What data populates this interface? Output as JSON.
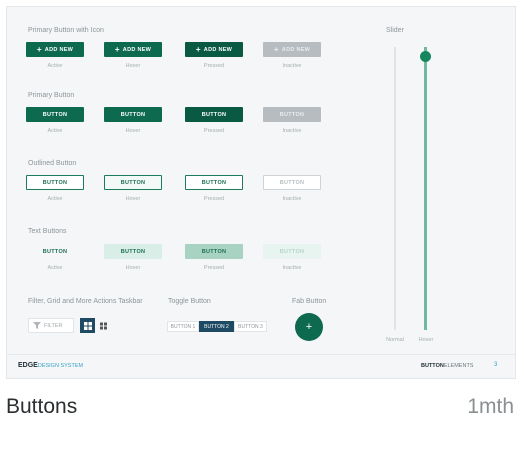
{
  "sections": {
    "primary_icon": {
      "title": "Primary Button with Icon",
      "buttons": [
        {
          "label": "ADD NEW",
          "caption": "Active"
        },
        {
          "label": "ADD NEW",
          "caption": "Hover"
        },
        {
          "label": "ADD NEW",
          "caption": "Pressed"
        },
        {
          "label": "ADD NEW",
          "caption": "Inactive"
        }
      ]
    },
    "primary": {
      "title": "Primary Button",
      "buttons": [
        {
          "label": "BUTTON",
          "caption": "Active"
        },
        {
          "label": "BUTTON",
          "caption": "Hover"
        },
        {
          "label": "BUTTON",
          "caption": "Pressed"
        },
        {
          "label": "BUTTON",
          "caption": "Inactive"
        }
      ]
    },
    "outlined": {
      "title": "Outlined Button",
      "buttons": [
        {
          "label": "BUTTON",
          "caption": "Active"
        },
        {
          "label": "BUTTON",
          "caption": "Hover"
        },
        {
          "label": "BUTTON",
          "caption": "Pressed"
        },
        {
          "label": "BUTTON",
          "caption": "Inactive"
        }
      ]
    },
    "text": {
      "title": "Text Buttons",
      "buttons": [
        {
          "label": "BUTTON",
          "caption": "Active"
        },
        {
          "label": "BUTTON",
          "caption": "Hover"
        },
        {
          "label": "BUTTON",
          "caption": "Pressed"
        },
        {
          "label": "BUTTON",
          "caption": "Inactive"
        }
      ]
    },
    "filter_bar": {
      "title": "Filter, Grid and More Actions Taskbar",
      "filter_label": "FILTER"
    },
    "toggle": {
      "title": "Toggle Button",
      "options": [
        "BUTTON 1",
        "BUTTON 2",
        "BUTTON 3"
      ],
      "selected": "BUTTON 2"
    },
    "fab": {
      "title": "Fab Button",
      "symbol": "+"
    },
    "slider": {
      "title": "Slider",
      "captions": [
        "Normal",
        "Hover"
      ]
    }
  },
  "footer": {
    "brand": "EDGE",
    "brand_sub": "DESIGN SYSTEM",
    "section": "BUTTON",
    "section_sub": "ELEMENTS",
    "page": "3"
  },
  "card_title": "Buttons",
  "card_time": "1mth",
  "colors": {
    "primary": "#0e6a4f",
    "accent_light": "#d8eee6",
    "disabled": "#b6bcbf"
  }
}
